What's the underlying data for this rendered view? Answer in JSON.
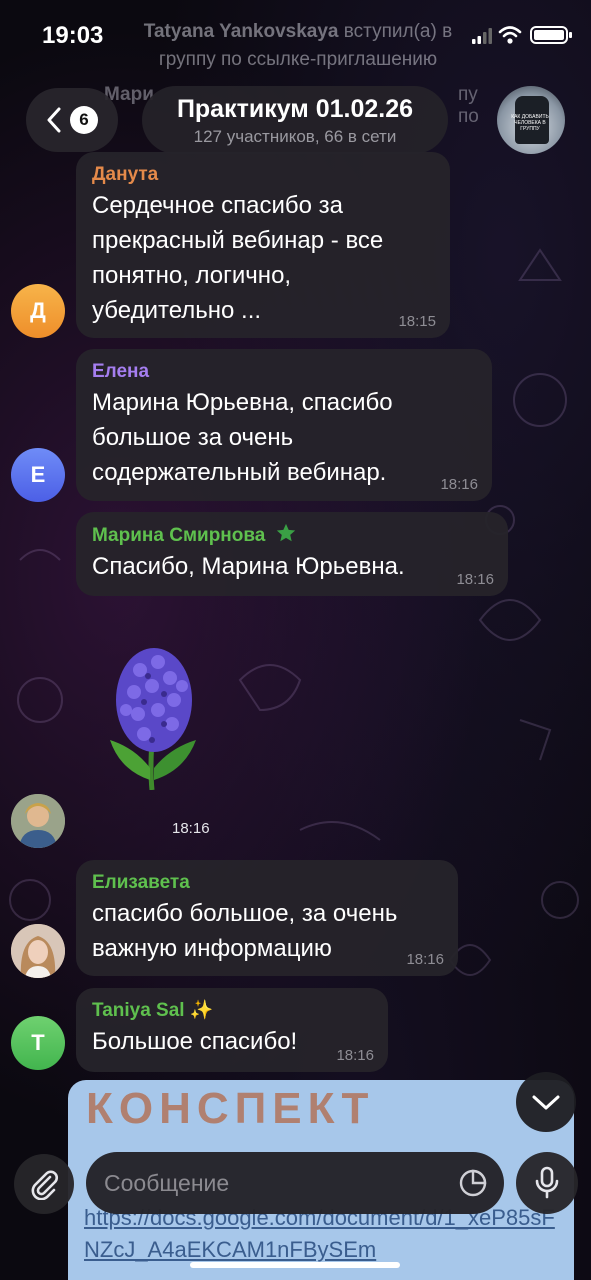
{
  "status_bar": {
    "time": "19:03",
    "system_message_name": "Tatyana Yankovskaya",
    "system_message_rest": " вступил(а) в группу по ссылке-приглашению"
  },
  "header": {
    "unread_count": "6",
    "title": "Практикум 01.02.26",
    "subtitle": "127 участников, 66 в сети",
    "peek_left": "Мари",
    "peek_right": "пу по",
    "avatar_caption": "КАК ДОБАВИТЬ ЧЕЛОВЕКА В ГРУППУ"
  },
  "messages": [
    {
      "sender": "Данута",
      "sender_color": "#e58a4a",
      "text": "Сердечное спасибо за прекрасный вебинар - все понятно, логично, убедительно ...",
      "time": "18:15",
      "avatar_letter": "Д"
    },
    {
      "sender": "Елена",
      "sender_color": "#a57ef0",
      "text": "Марина Юрьевна, спасибо большое за очень содержательный вебинар.",
      "time": "18:16",
      "avatar_letter": "Е"
    },
    {
      "sender": "Марина Смирнова",
      "sender_color": "#5fc04e",
      "text": "Спасибо, Марина Юрьевна.",
      "time": "18:16",
      "badge": "star"
    },
    {
      "sticker_time": "18:16",
      "sticker": "hyacinth"
    },
    {
      "sender": "Елизавета",
      "sender_color": "#5fc04e",
      "text": "спасибо большое, за очень важную информацию",
      "time": "18:16"
    },
    {
      "sender": "Taniya Sal",
      "sender_color": "#5fc04e",
      "sender_badge": "✨",
      "text": "Большое спасибо!",
      "time": "18:16",
      "avatar_letter": "T"
    }
  ],
  "doc_preview": {
    "title": "КОНСПЕКТ",
    "link": "https://docs.google.com/document/d/1_xeP85sFNZcJ_A4aEKCAM1nFBySEm"
  },
  "composer": {
    "placeholder": "Сообщение"
  },
  "colors": {
    "bubble": "#26242a",
    "avatar_orange": "#f2a43a",
    "avatar_blue": "#5a78f0",
    "avatar_green": "#52c05a"
  }
}
